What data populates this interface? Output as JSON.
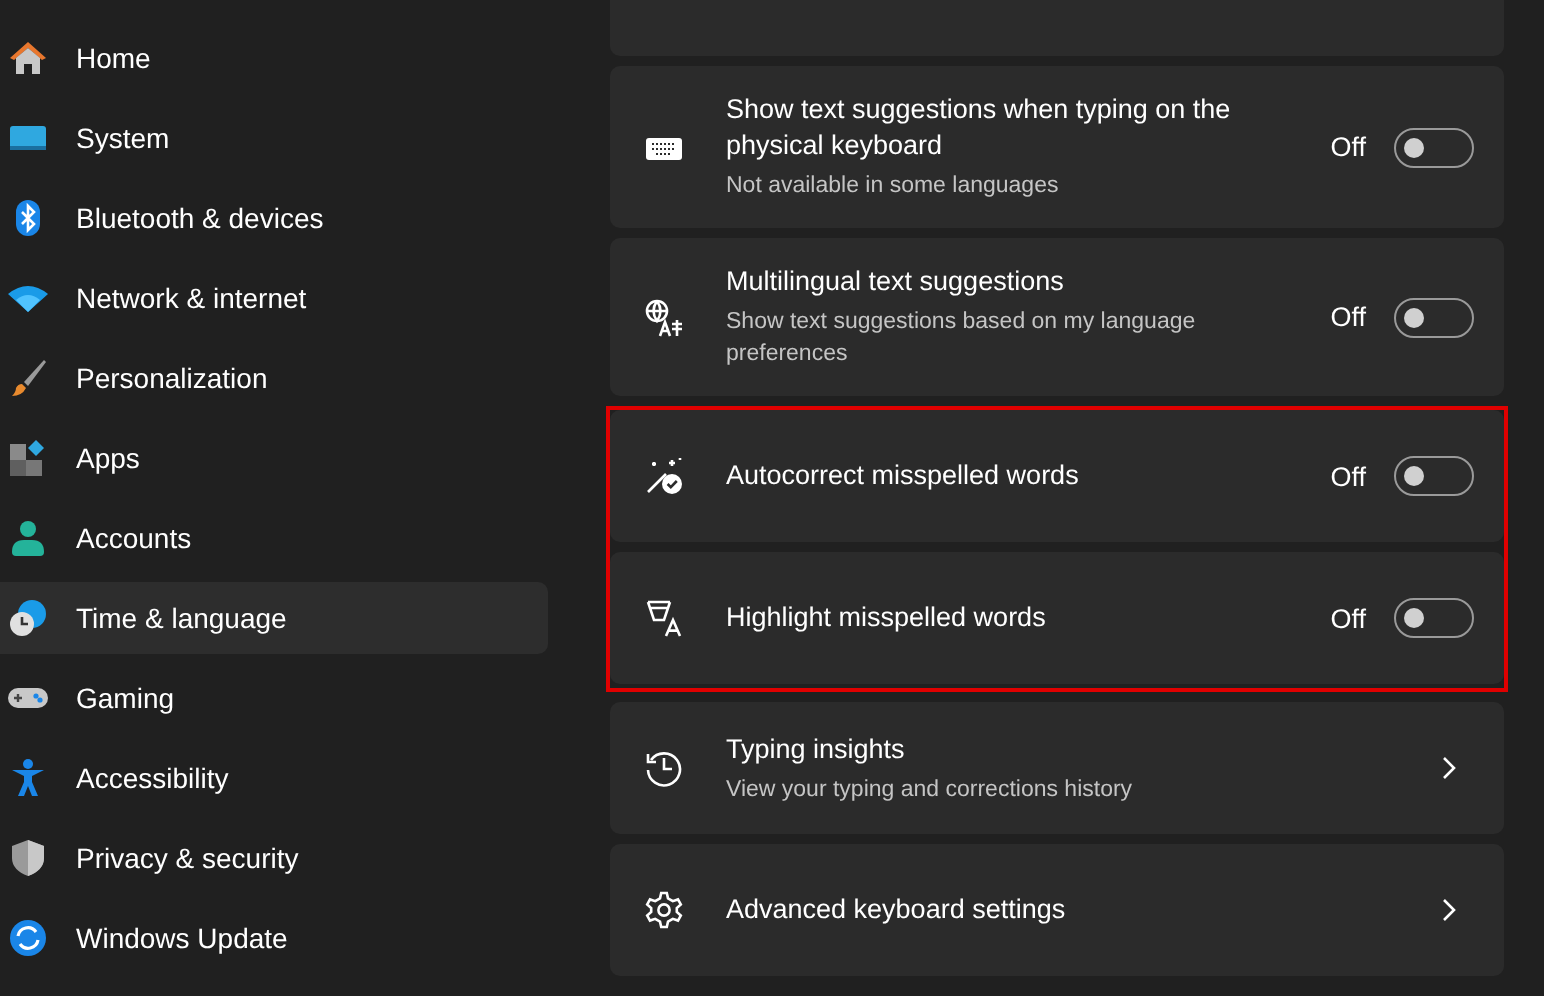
{
  "sidebar": {
    "items": [
      {
        "label": "Home",
        "selected": false
      },
      {
        "label": "System",
        "selected": false
      },
      {
        "label": "Bluetooth & devices",
        "selected": false
      },
      {
        "label": "Network & internet",
        "selected": false
      },
      {
        "label": "Personalization",
        "selected": false
      },
      {
        "label": "Apps",
        "selected": false
      },
      {
        "label": "Accounts",
        "selected": false
      },
      {
        "label": "Time & language",
        "selected": true
      },
      {
        "label": "Gaming",
        "selected": false
      },
      {
        "label": "Accessibility",
        "selected": false
      },
      {
        "label": "Privacy & security",
        "selected": false
      },
      {
        "label": "Windows Update",
        "selected": false
      }
    ]
  },
  "settings": [
    {
      "kind": "toggle",
      "title": "Show text suggestions when typing on the physical keyboard",
      "description": "Not available in some languages",
      "state_label": "Off",
      "on": false,
      "highlighted": false
    },
    {
      "kind": "toggle",
      "title": "Multilingual text suggestions",
      "description": "Show text suggestions based on my language preferences",
      "state_label": "Off",
      "on": false,
      "highlighted": false
    },
    {
      "kind": "toggle",
      "title": "Autocorrect misspelled words",
      "state_label": "Off",
      "on": false,
      "highlighted": true
    },
    {
      "kind": "toggle",
      "title": "Highlight misspelled words",
      "state_label": "Off",
      "on": false,
      "highlighted": true
    },
    {
      "kind": "link",
      "title": "Typing insights",
      "description": "View your typing and corrections history",
      "highlighted": false
    },
    {
      "kind": "link",
      "title": "Advanced keyboard settings",
      "highlighted": false
    }
  ]
}
